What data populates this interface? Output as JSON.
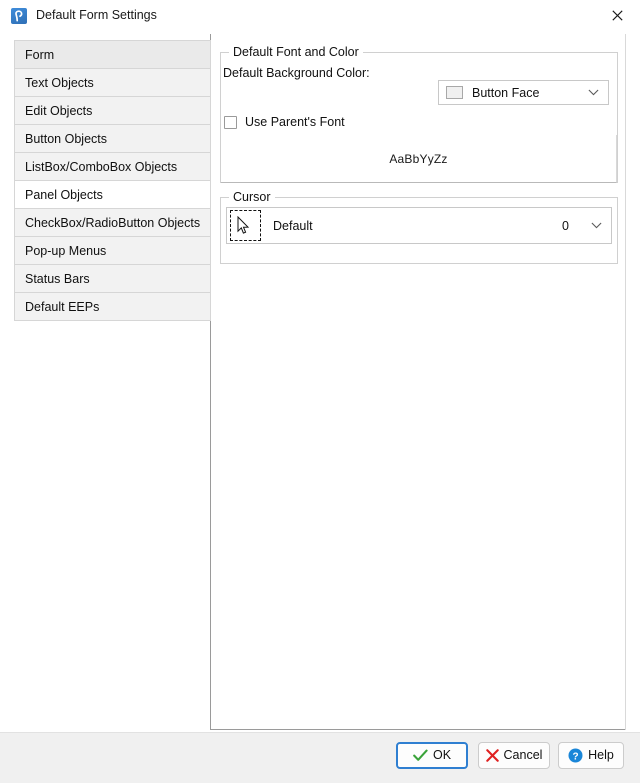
{
  "window": {
    "title": "Default Form Settings",
    "icon": "app-icon",
    "close_icon": "close-icon"
  },
  "sidebar": {
    "items": [
      {
        "label": "Form",
        "state": "selected"
      },
      {
        "label": "Text Objects",
        "state": "normal"
      },
      {
        "label": "Edit Objects",
        "state": "normal"
      },
      {
        "label": "Button Objects",
        "state": "normal"
      },
      {
        "label": "ListBox/ComboBox Objects",
        "state": "normal"
      },
      {
        "label": "Panel Objects",
        "state": "hovered"
      },
      {
        "label": "CheckBox/RadioButton Objects",
        "state": "normal"
      },
      {
        "label": "Pop-up Menus",
        "state": "normal"
      },
      {
        "label": "Status Bars",
        "state": "normal"
      },
      {
        "label": "Default EEPs",
        "state": "normal"
      }
    ]
  },
  "main": {
    "font_group": {
      "title": "Default Font and Color",
      "bg_color_label": "Default Background Color:",
      "bg_color_value": "Button Face",
      "bg_color_swatch": "#f0f0f0",
      "chevron_icon": "chevron-down-icon",
      "use_parents_font_label": "Use Parent's Font",
      "use_parents_font_checked": false,
      "preview_sample": "AaBbYyZz"
    },
    "cursor_group": {
      "title": "Cursor",
      "cursor_icon": "mouse-pointer-icon",
      "cursor_name": "Default",
      "cursor_value": "0",
      "chevron_icon": "chevron-down-icon"
    }
  },
  "footer": {
    "ok_label": "OK",
    "ok_icon": "check-icon",
    "cancel_label": "Cancel",
    "cancel_icon": "x-icon",
    "help_label": "Help",
    "help_icon": "question-circle-icon"
  },
  "colors": {
    "accent": "#2f7fd1",
    "ok_check": "#3aa33a",
    "cancel_x": "#e02020",
    "help_blue": "#1a86d8",
    "list_bg": "#f2f2f2",
    "list_border": "#d6d6d6",
    "footer_bg": "#f0f0f0"
  }
}
